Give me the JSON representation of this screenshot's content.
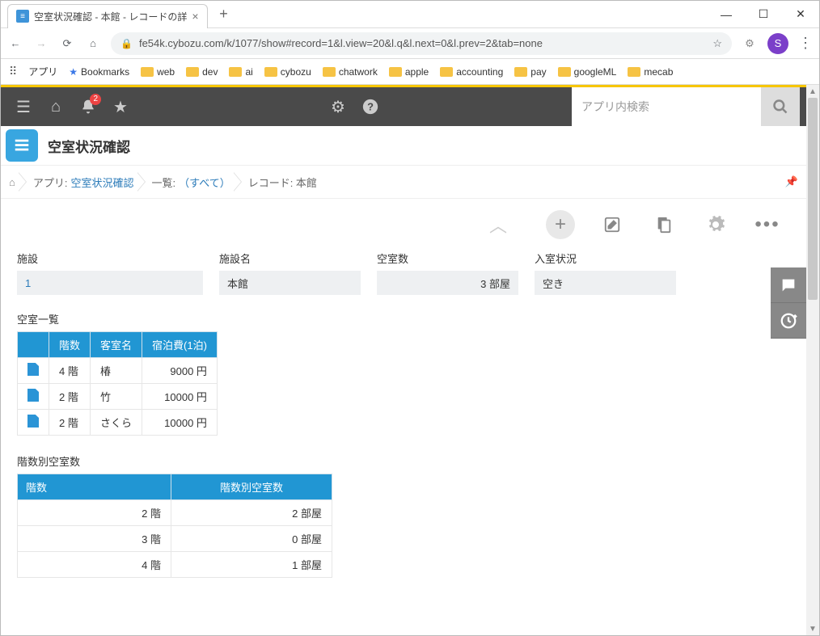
{
  "browser": {
    "tab_title": "空室状況確認 - 本館 - レコードの詳",
    "url": "fe54k.cybozu.com/k/1077/show#record=1&l.view=20&l.q&l.next=0&l.prev=2&tab=none",
    "avatar_letter": "S"
  },
  "bookmarks": {
    "apps_label": "アプリ",
    "bookmarks_label": "Bookmarks",
    "items": [
      "web",
      "dev",
      "ai",
      "cybozu",
      "chatwork",
      "apple",
      "accounting",
      "pay",
      "googleML",
      "mecab"
    ]
  },
  "header": {
    "notification_count": "2",
    "search_placeholder": "アプリ内検索"
  },
  "app": {
    "title": "空室状況確認"
  },
  "breadcrumbs": {
    "app_prefix": "アプリ: ",
    "app_link": "空室状況確認",
    "list_prefix": "一覧: ",
    "list_link": "（すべて）",
    "record_label": "レコード: 本館"
  },
  "fields": {
    "facility_label": "施設",
    "facility_value": "1",
    "facility_name_label": "施設名",
    "facility_name_value": "本館",
    "vacancy_label": "空室数",
    "vacancy_value": "3 部屋",
    "status_label": "入室状況",
    "status_value": "空き"
  },
  "table1": {
    "title": "空室一覧",
    "headers": [
      "階数",
      "客室名",
      "宿泊費(1泊)"
    ],
    "rows": [
      {
        "floor": "4 階",
        "room": "椿",
        "price": "9000 円"
      },
      {
        "floor": "2 階",
        "room": "竹",
        "price": "10000 円"
      },
      {
        "floor": "2 階",
        "room": "さくら",
        "price": "10000 円"
      }
    ]
  },
  "table2": {
    "title": "階数別空室数",
    "headers": [
      "階数",
      "階数別空室数"
    ],
    "rows": [
      {
        "floor": "2 階",
        "count": "2 部屋"
      },
      {
        "floor": "3 階",
        "count": "0 部屋"
      },
      {
        "floor": "4 階",
        "count": "1 部屋"
      }
    ]
  }
}
